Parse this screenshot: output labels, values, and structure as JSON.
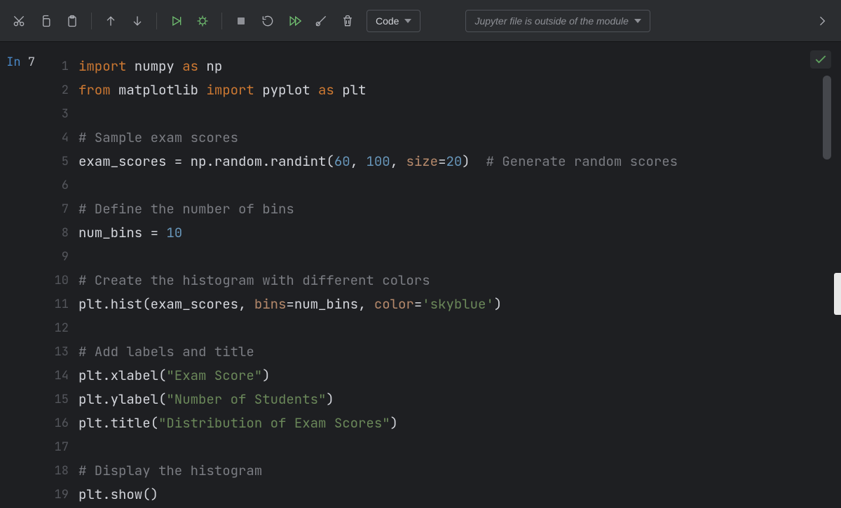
{
  "toolbar": {
    "cell_type": "Code",
    "module_placeholder": "Jupyter file is outside of the module"
  },
  "cell": {
    "prompt_in": "In",
    "prompt_num": "7",
    "line_numbers": [
      "1",
      "2",
      "3",
      "4",
      "5",
      "6",
      "7",
      "8",
      "9",
      "10",
      "11",
      "12",
      "13",
      "14",
      "15",
      "16",
      "17",
      "18",
      "19"
    ],
    "lines": [
      {
        "t": [
          {
            "c": "kw",
            "v": "import"
          },
          {
            "c": "id",
            "v": " numpy "
          },
          {
            "c": "kw",
            "v": "as"
          },
          {
            "c": "id",
            "v": " np"
          }
        ]
      },
      {
        "t": [
          {
            "c": "kw",
            "v": "from"
          },
          {
            "c": "id",
            "v": " matplotlib "
          },
          {
            "c": "kw",
            "v": "import"
          },
          {
            "c": "id",
            "v": " pyplot "
          },
          {
            "c": "kw",
            "v": "as"
          },
          {
            "c": "id",
            "v": " plt"
          }
        ]
      },
      {
        "t": []
      },
      {
        "t": [
          {
            "c": "cm",
            "v": "# Sample exam scores"
          }
        ]
      },
      {
        "t": [
          {
            "c": "id",
            "v": "exam_scores = np.random.randint("
          },
          {
            "c": "num",
            "v": "60"
          },
          {
            "c": "id",
            "v": ", "
          },
          {
            "c": "num",
            "v": "100"
          },
          {
            "c": "id",
            "v": ", "
          },
          {
            "c": "kwarg",
            "v": "size"
          },
          {
            "c": "id",
            "v": "="
          },
          {
            "c": "num",
            "v": "20"
          },
          {
            "c": "id",
            "v": ")  "
          },
          {
            "c": "cm",
            "v": "# Generate random scores"
          }
        ]
      },
      {
        "t": []
      },
      {
        "t": [
          {
            "c": "cm",
            "v": "# Define the number of bins"
          }
        ]
      },
      {
        "t": [
          {
            "c": "id",
            "v": "num_bins = "
          },
          {
            "c": "num",
            "v": "10"
          }
        ]
      },
      {
        "t": []
      },
      {
        "t": [
          {
            "c": "cm",
            "v": "# Create the histogram with different colors"
          }
        ]
      },
      {
        "t": [
          {
            "c": "id",
            "v": "plt.hist(exam_scores, "
          },
          {
            "c": "kwarg",
            "v": "bins"
          },
          {
            "c": "id",
            "v": "=num_bins, "
          },
          {
            "c": "kwarg",
            "v": "color"
          },
          {
            "c": "id",
            "v": "="
          },
          {
            "c": "str",
            "v": "'skyblue'"
          },
          {
            "c": "id",
            "v": ")"
          }
        ]
      },
      {
        "t": []
      },
      {
        "t": [
          {
            "c": "cm",
            "v": "# Add labels and title"
          }
        ]
      },
      {
        "t": [
          {
            "c": "id",
            "v": "plt.xlabel("
          },
          {
            "c": "str",
            "v": "\"Exam Score\""
          },
          {
            "c": "id",
            "v": ")"
          }
        ]
      },
      {
        "t": [
          {
            "c": "id",
            "v": "plt.ylabel("
          },
          {
            "c": "str",
            "v": "\"Number of Students\""
          },
          {
            "c": "id",
            "v": ")"
          }
        ]
      },
      {
        "t": [
          {
            "c": "id",
            "v": "plt.title("
          },
          {
            "c": "str",
            "v": "\"Distribution of Exam Scores\""
          },
          {
            "c": "id",
            "v": ")"
          }
        ]
      },
      {
        "t": []
      },
      {
        "t": [
          {
            "c": "cm",
            "v": "# Display the histogram"
          }
        ]
      },
      {
        "t": [
          {
            "c": "id",
            "v": "plt.show()"
          }
        ]
      }
    ]
  }
}
